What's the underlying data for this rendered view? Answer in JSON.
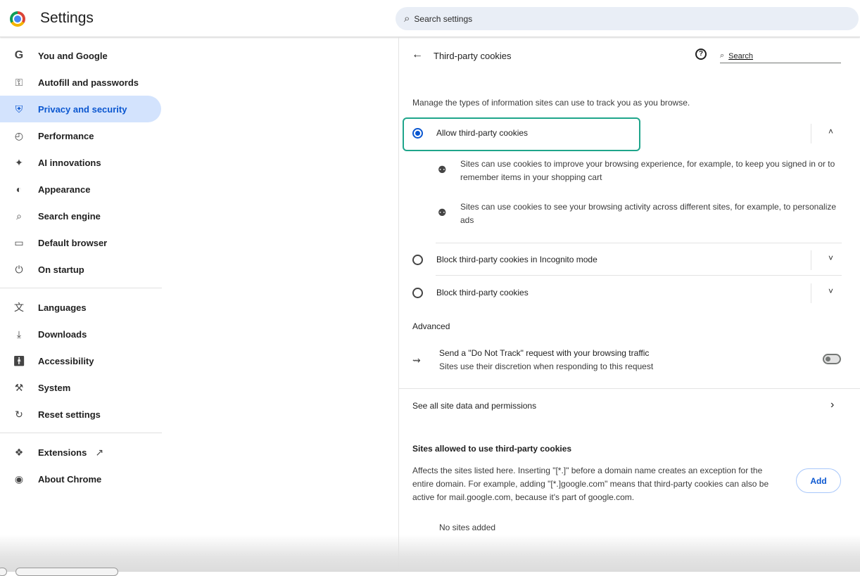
{
  "header": {
    "title": "Settings",
    "search_placeholder": "Search settings"
  },
  "sidebar": {
    "items": [
      {
        "label": "You and Google",
        "icon": "google-g-icon"
      },
      {
        "label": "Autofill and passwords",
        "icon": "key-icon"
      },
      {
        "label": "Privacy and security",
        "icon": "shield-icon",
        "active": true
      },
      {
        "label": "Performance",
        "icon": "speedometer-icon"
      },
      {
        "label": "AI innovations",
        "icon": "sparkle-icon"
      },
      {
        "label": "Appearance",
        "icon": "palette-icon"
      },
      {
        "label": "Search engine",
        "icon": "search-icon"
      },
      {
        "label": "Default browser",
        "icon": "browser-window-icon"
      },
      {
        "label": "On startup",
        "icon": "power-icon"
      },
      {
        "label": "Languages",
        "icon": "translate-icon"
      },
      {
        "label": "Downloads",
        "icon": "download-icon"
      },
      {
        "label": "Accessibility",
        "icon": "accessibility-icon"
      },
      {
        "label": "System",
        "icon": "wrench-icon"
      },
      {
        "label": "Reset settings",
        "icon": "reset-icon"
      },
      {
        "label": "Extensions",
        "icon": "puzzle-icon"
      },
      {
        "label": "About Chrome",
        "icon": "chrome-icon"
      }
    ]
  },
  "subpage": {
    "title": "Third-party cookies",
    "search_placeholder": "Search",
    "intro": "Manage the types of information sites can use to track you as you browse.",
    "options": [
      {
        "label": "Allow third-party cookies",
        "selected": true,
        "expanded": true
      },
      {
        "label": "Block third-party cookies in Incognito mode",
        "selected": false
      },
      {
        "label": "Block third-party cookies",
        "selected": false
      }
    ],
    "details": [
      "Sites can use cookies to improve your browsing experience, for example, to keep you signed in or to remember items in your shopping cart",
      "Sites can use cookies to see your browsing activity across different sites, for example, to personalize ads"
    ],
    "advanced_heading": "Advanced",
    "dnt_title": "Send a \"Do Not Track\" request with your browsing traffic",
    "dnt_subtitle": "Sites use their discretion when responding to this request",
    "dnt_enabled": false,
    "see_all_label": "See all site data and permissions",
    "allowed_heading": "Sites allowed to use third-party cookies",
    "allowed_desc": "Affects the sites listed here. Inserting \"[*.]\" before a domain name creates an exception for the entire domain. For example, adding \"[*.]google.com\" means that third-party cookies can also be active for mail.google.com, because it's part of google.com.",
    "add_label": "Add",
    "no_sites": "No sites added"
  },
  "colors": {
    "accent": "#0b57d0",
    "active_nav_bg": "#d3e3fd",
    "highlight_border": "#1fa58b"
  }
}
